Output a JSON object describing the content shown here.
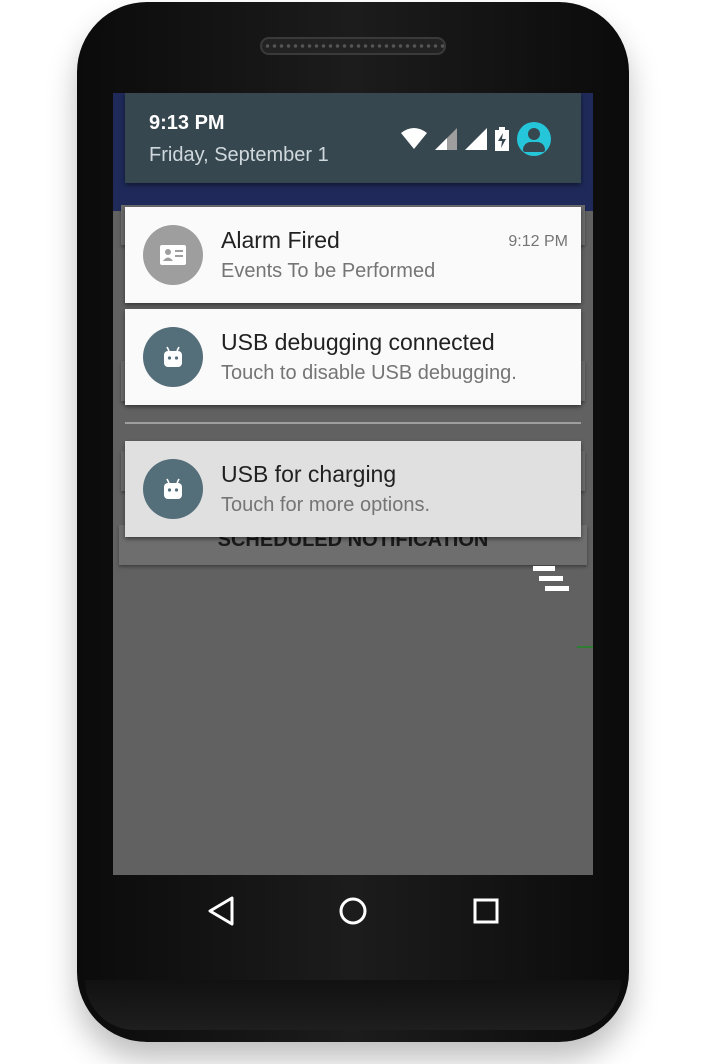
{
  "status": {
    "time": "9:13 PM",
    "date": "Friday, September 1",
    "icons": [
      "wifi-icon",
      "signal-icon",
      "signal-full-icon",
      "battery-charging-icon",
      "account-avatar-icon"
    ]
  },
  "notifications": [
    {
      "title": "Alarm Fired",
      "text": "Events To be Performed",
      "time": "9:12 PM",
      "icon": "contact-card-icon",
      "icon_bg": "#9e9e9e"
    },
    {
      "title": "USB debugging connected",
      "text": "Touch to disable USB debugging.",
      "icon": "android-icon",
      "icon_bg": "#546e7a"
    },
    {
      "title": "USB for charging",
      "text": "Touch for more options.",
      "icon": "android-icon",
      "icon_bg": "#546e7a"
    }
  ],
  "background_label": "SCHEDULED NOTIFICATION",
  "clear_all": {
    "icon": "clear-all-icon"
  },
  "navbar": {
    "icons": [
      "back-icon",
      "home-icon",
      "recents-icon"
    ]
  },
  "colors": {
    "accent": "#26c6da",
    "header": "#37474f",
    "shade": "#616161"
  }
}
